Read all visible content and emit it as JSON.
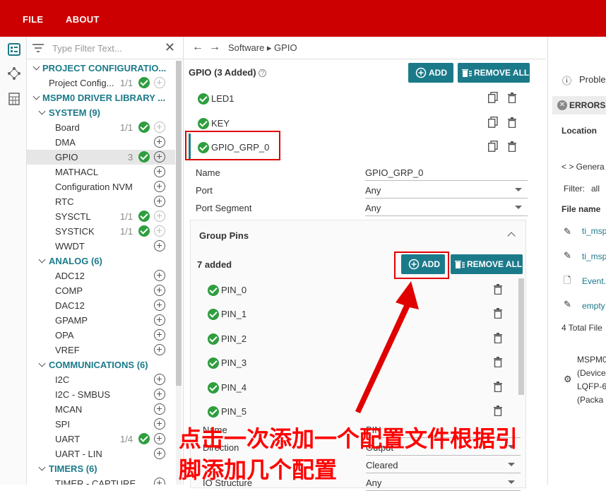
{
  "menu": {
    "file": "FILE",
    "about": "ABOUT"
  },
  "filter": {
    "placeholder": "Type Filter Text..."
  },
  "tree": {
    "project_config": "PROJECT CONFIGURATIO...",
    "project_config_item": {
      "label": "Project Config...",
      "count": "1/1"
    },
    "driver_lib": "MSPM0 DRIVER LIBRARY ...",
    "system": "SYSTEM (9)",
    "system_items": [
      {
        "label": "Board",
        "count": "1/1"
      },
      {
        "label": "DMA",
        "count": ""
      },
      {
        "label": "GPIO",
        "count": "3"
      },
      {
        "label": "MATHACL",
        "count": ""
      },
      {
        "label": "Configuration NVM",
        "count": ""
      },
      {
        "label": "RTC",
        "count": ""
      },
      {
        "label": "SYSCTL",
        "count": "1/1"
      },
      {
        "label": "SYSTICK",
        "count": "1/1"
      },
      {
        "label": "WWDT",
        "count": ""
      }
    ],
    "analog": "ANALOG (6)",
    "analog_items": [
      "ADC12",
      "COMP",
      "DAC12",
      "GPAMP",
      "OPA",
      "VREF"
    ],
    "comms": "COMMUNICATIONS (6)",
    "comms_items": [
      {
        "label": "I2C",
        "count": ""
      },
      {
        "label": "I2C - SMBUS",
        "count": ""
      },
      {
        "label": "MCAN",
        "count": ""
      },
      {
        "label": "SPI",
        "count": ""
      },
      {
        "label": "UART",
        "count": "1/4"
      },
      {
        "label": "UART - LIN",
        "count": ""
      }
    ],
    "timers": "TIMERS (6)",
    "timers_items": [
      "TIMER - CAPTURE"
    ]
  },
  "breadcrumb": {
    "back": "←",
    "forward": "→",
    "path": "Software ▸ GPIO"
  },
  "gpio": {
    "title": "GPIO (3 Added)",
    "add_label": "ADD",
    "remove_all_label": "REMOVE ALL",
    "instances": [
      "LED1",
      "KEY",
      "GPIO_GRP_0"
    ]
  },
  "props": {
    "name_label": "Name",
    "name_value": "GPIO_GRP_0",
    "port_label": "Port",
    "port_value": "Any",
    "segment_label": "Port Segment",
    "segment_value": "Any"
  },
  "group_pins": {
    "title": "Group Pins",
    "count_text": "7 added",
    "add_label": "ADD",
    "remove_all_label": "REMOVE ALL",
    "pins": [
      "PIN_0",
      "PIN_1",
      "PIN_2",
      "PIN_3",
      "PIN_4",
      "PIN_5"
    ]
  },
  "pin_props": {
    "name_label": "Name",
    "name_value": "PIN",
    "direction_label": "Direction",
    "direction_value": "Output",
    "initial_value": "Cleared",
    "io_label": "IO Structure",
    "io_value": "Any"
  },
  "problems": {
    "title": "Proble",
    "errors": "ERRORS",
    "location": "Location",
    "general": "< > Genera",
    "filter_label": "Filter:",
    "filter_value": "all",
    "file_name": "File name",
    "files": [
      "ti_msp",
      "ti_msp",
      "Event.",
      "empty"
    ],
    "total": "4 Total File",
    "device_lines": [
      "MSPM0",
      "(Device",
      "LQFP-6",
      "(Packa"
    ]
  },
  "annotation": {
    "line1": "点击一次添加一个配置文件根据引",
    "line2": "脚添加几个配置"
  },
  "colors": {
    "brand_red": "#cc0000",
    "teal": "#1b7a8a",
    "ok_green": "#2e9e3e",
    "annot_red": "#ff0000"
  }
}
